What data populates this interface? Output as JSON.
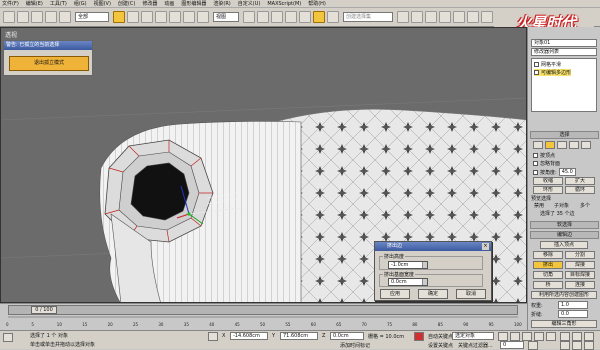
{
  "menu": [
    "文件(F)",
    "编辑(E)",
    "工具(T)",
    "组(G)",
    "视图(V)",
    "创建(C)",
    "修改器",
    "动画",
    "图形编辑器",
    "渲染(R)",
    "自定义(U)",
    "MAXScript(M)",
    "帮助(H)"
  ],
  "toolbar": {
    "filter_value": "全部",
    "view_value": "视图",
    "selection_set_placeholder": "创建选择集"
  },
  "brand": {
    "text": "火星时代",
    "sub": "www.hxsd.com"
  },
  "viewport": {
    "label": "透视"
  },
  "isolate_dialog": {
    "title": "警告: 已孤立的当前选择",
    "button": "退出孤立模式"
  },
  "extrude_dialog": {
    "title": "挤出边",
    "height_label": "挤出高度",
    "height_value": "-1.0cm",
    "width_label": "挤出基面宽度",
    "width_value": "0.0cm",
    "apply": "应用",
    "ok": "确定",
    "cancel": "取消",
    "close": "×"
  },
  "right_panel": {
    "object_name": "对象01",
    "modifier_list": "修改器列表",
    "stack": [
      "网格平滑",
      "可编辑多边形"
    ],
    "selection_rollout": "选择",
    "by_vertex": "按顶点",
    "ignore_backfacing": "忽略背面",
    "by_angle": "按角度:",
    "by_angle_value": "45.0",
    "shrink": "收缩",
    "grow": "扩大",
    "ring": "环形",
    "loop": "循环",
    "preview_selection": "预览选择",
    "off": "禁用",
    "subobj": "子对象",
    "multi": "多个",
    "selected_info": "选择了 35 个边",
    "soft_selection": "软选择",
    "edit_edges": "编辑边",
    "insert_vertex": "插入顶点",
    "remove": "移除",
    "split": "分割",
    "extrude": "挤出",
    "weld": "焊接",
    "chamfer": "切角",
    "target_weld": "目标焊接",
    "bridge": "桥",
    "connect": "连接",
    "create_shape": "利用所选内容创建图形",
    "weight": "权重:",
    "weight_value": "1.0",
    "crease": "折缝:",
    "crease_value": "0.0",
    "edit_tri": "编辑三角形"
  },
  "timeline": {
    "frame": "0 / 100",
    "ticks": [
      "0",
      "5",
      "10",
      "15",
      "20",
      "25",
      "30",
      "35",
      "40",
      "45",
      "50",
      "55",
      "60",
      "65",
      "70",
      "75",
      "80",
      "85",
      "90",
      "95",
      "100"
    ]
  },
  "status": {
    "selected": "选择了 1 个 对象",
    "hint": "单击或单击并拖动以选择对象",
    "x_value": "-14.608cm",
    "y_value": "71.608cm",
    "z_value": "0.0cm",
    "grid": "栅格 = 10.0cm",
    "add_time_tag": "添加时间标记",
    "auto_key": "自动关键点",
    "selected_obj": "选定对象",
    "set_key": "设置关键点",
    "key_filters": "关键点过滤器...",
    "frame_value": "0"
  }
}
